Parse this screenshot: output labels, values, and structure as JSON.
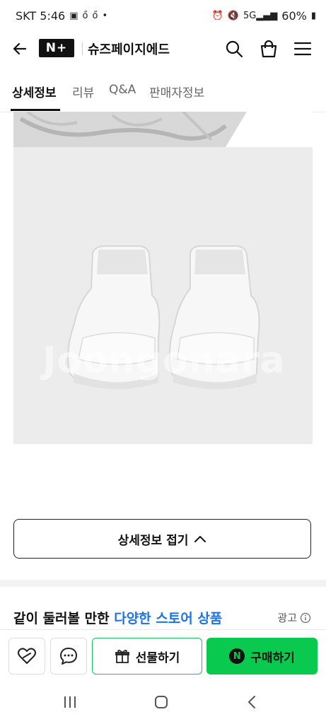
{
  "status_bar": {
    "time": "SKT 5:46",
    "battery": "60%"
  },
  "header": {
    "logo": "N+",
    "store_name": "슈즈페이지에드"
  },
  "tabs": [
    {
      "label": "상세정보"
    },
    {
      "label": "리뷰"
    },
    {
      "label": "Q&A"
    },
    {
      "label": "판매자정보"
    }
  ],
  "product_image": {
    "watermark": "Joongonara"
  },
  "collapse_button": {
    "label": "상세정보 접기"
  },
  "recommend_section": {
    "title_prefix": "같이 둘러볼 만한 ",
    "title_accent": "다양한 스토어 상품",
    "ad_label": "광고"
  },
  "bottom_bar": {
    "gift_label": "선물하기",
    "buy_label": "구매하기",
    "buy_badge": "N"
  },
  "colors": {
    "buy_green": "#09c94f",
    "accent_blue": "#1a73e8"
  }
}
